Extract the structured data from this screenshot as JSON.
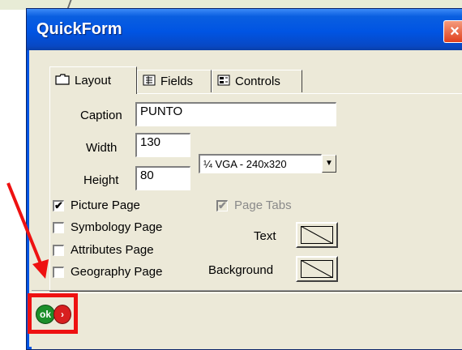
{
  "window": {
    "title": "QuickForm",
    "close_glyph": "×"
  },
  "tabs": [
    {
      "label": "Layout",
      "icon": "folder-icon",
      "active": true
    },
    {
      "label": "Fields",
      "icon": "fields-list-icon",
      "active": false
    },
    {
      "label": "Controls",
      "icon": "controls-icon",
      "active": false
    }
  ],
  "layout": {
    "caption_label": "Caption",
    "caption_value": "PUNTO",
    "width_label": "Width",
    "width_value": "130",
    "height_label": "Height",
    "height_value": "80",
    "size_select_value": "¼ VGA - 240x320"
  },
  "options": {
    "picture_page": {
      "label": "Picture Page",
      "checked": true,
      "mark": "✔"
    },
    "symbology_page": {
      "label": "Symbology Page",
      "checked": false
    },
    "attributes_page": {
      "label": "Attributes Page",
      "checked": false
    },
    "geography_page": {
      "label": "Geography Page",
      "checked": false
    },
    "page_tabs": {
      "label": "Page Tabs",
      "checked": true,
      "disabled": true,
      "mark": "✔"
    }
  },
  "colors_section": {
    "text_label": "Text",
    "background_label": "Background"
  },
  "footer": {
    "ok_label": "ok",
    "cancel_label": "›"
  },
  "annotation": {
    "color": "#ee1111"
  },
  "theme": {
    "titlebar": "#0054e3",
    "dialog_bg": "#ece9d8",
    "ok_green": "#1c8f2a",
    "cancel_red": "#d81f1f"
  }
}
